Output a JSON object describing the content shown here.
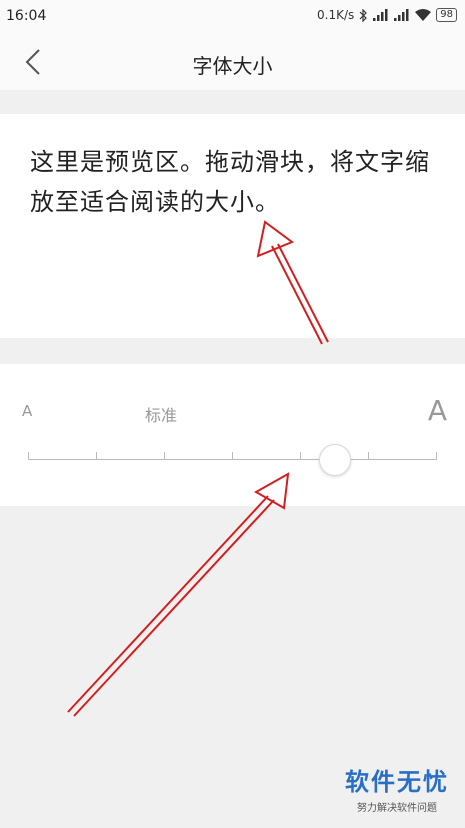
{
  "status_bar": {
    "time": "16:04",
    "speed": "0.1K/s",
    "battery": "98",
    "icons": [
      "bluetooth-icon",
      "signal-icon",
      "signal-icon",
      "wifi-icon",
      "battery-icon"
    ]
  },
  "nav": {
    "title": "字体大小",
    "back_icon": "chevron-left-icon"
  },
  "preview": {
    "text": "这里是预览区。拖动滑块，将文字缩放至适合阅读的大小。"
  },
  "slider": {
    "small_label": "A",
    "standard_label": "标准",
    "large_label": "A",
    "steps": 7,
    "selected_step": 5
  },
  "annotation": {
    "arrow_color": "#d21f1f"
  },
  "watermark": {
    "title": "软件无忧",
    "subtitle": "努力解决软件问题"
  }
}
